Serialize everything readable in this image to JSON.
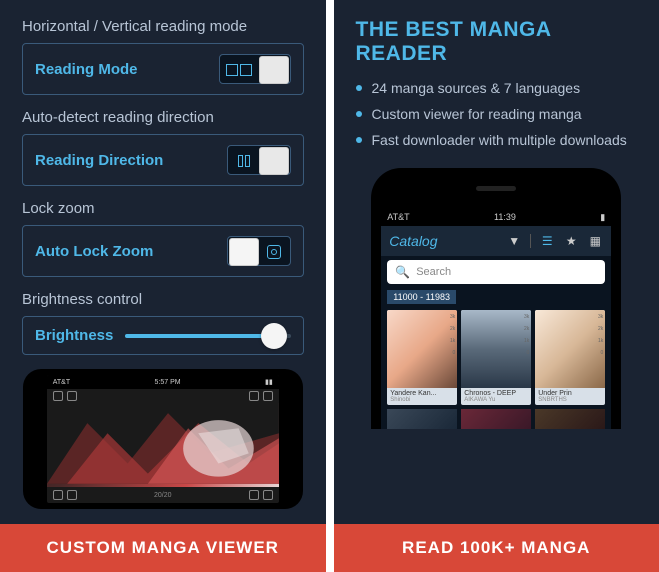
{
  "left": {
    "sections": {
      "mode": {
        "label": "Horizontal / Vertical reading mode",
        "setting": "Reading Mode"
      },
      "direction": {
        "label": "Auto-detect reading direction",
        "setting": "Reading Direction"
      },
      "zoom": {
        "label": "Lock zoom",
        "setting": "Auto Lock Zoom"
      },
      "brightness": {
        "label": "Brightness control",
        "setting": "Brightness"
      }
    },
    "phone": {
      "carrier": "AT&T",
      "time": "5:57 PM",
      "progress": "20/20"
    },
    "footer": "CUSTOM MANGA VIEWER"
  },
  "right": {
    "headline": "THE BEST MANGA READER",
    "bullets": [
      "24 manga sources & 7 languages",
      "Custom viewer for reading manga",
      "Fast downloader with multiple downloads"
    ],
    "phone": {
      "carrier": "AT&T",
      "time": "11:39",
      "nav_title": "Catalog",
      "search_placeholder": "Search",
      "range": "11000 - 11983",
      "cards": [
        {
          "title": "Yandere Kan...",
          "author": "Shinobi"
        },
        {
          "title": "Chronos - DEEP",
          "author": "AIKAWA Yu"
        },
        {
          "title": "Under Prin",
          "author": "SNBRTHS"
        }
      ],
      "scale": [
        "3k",
        "2k",
        "1k",
        "0"
      ]
    },
    "footer": "READ 100K+ MANGA"
  }
}
